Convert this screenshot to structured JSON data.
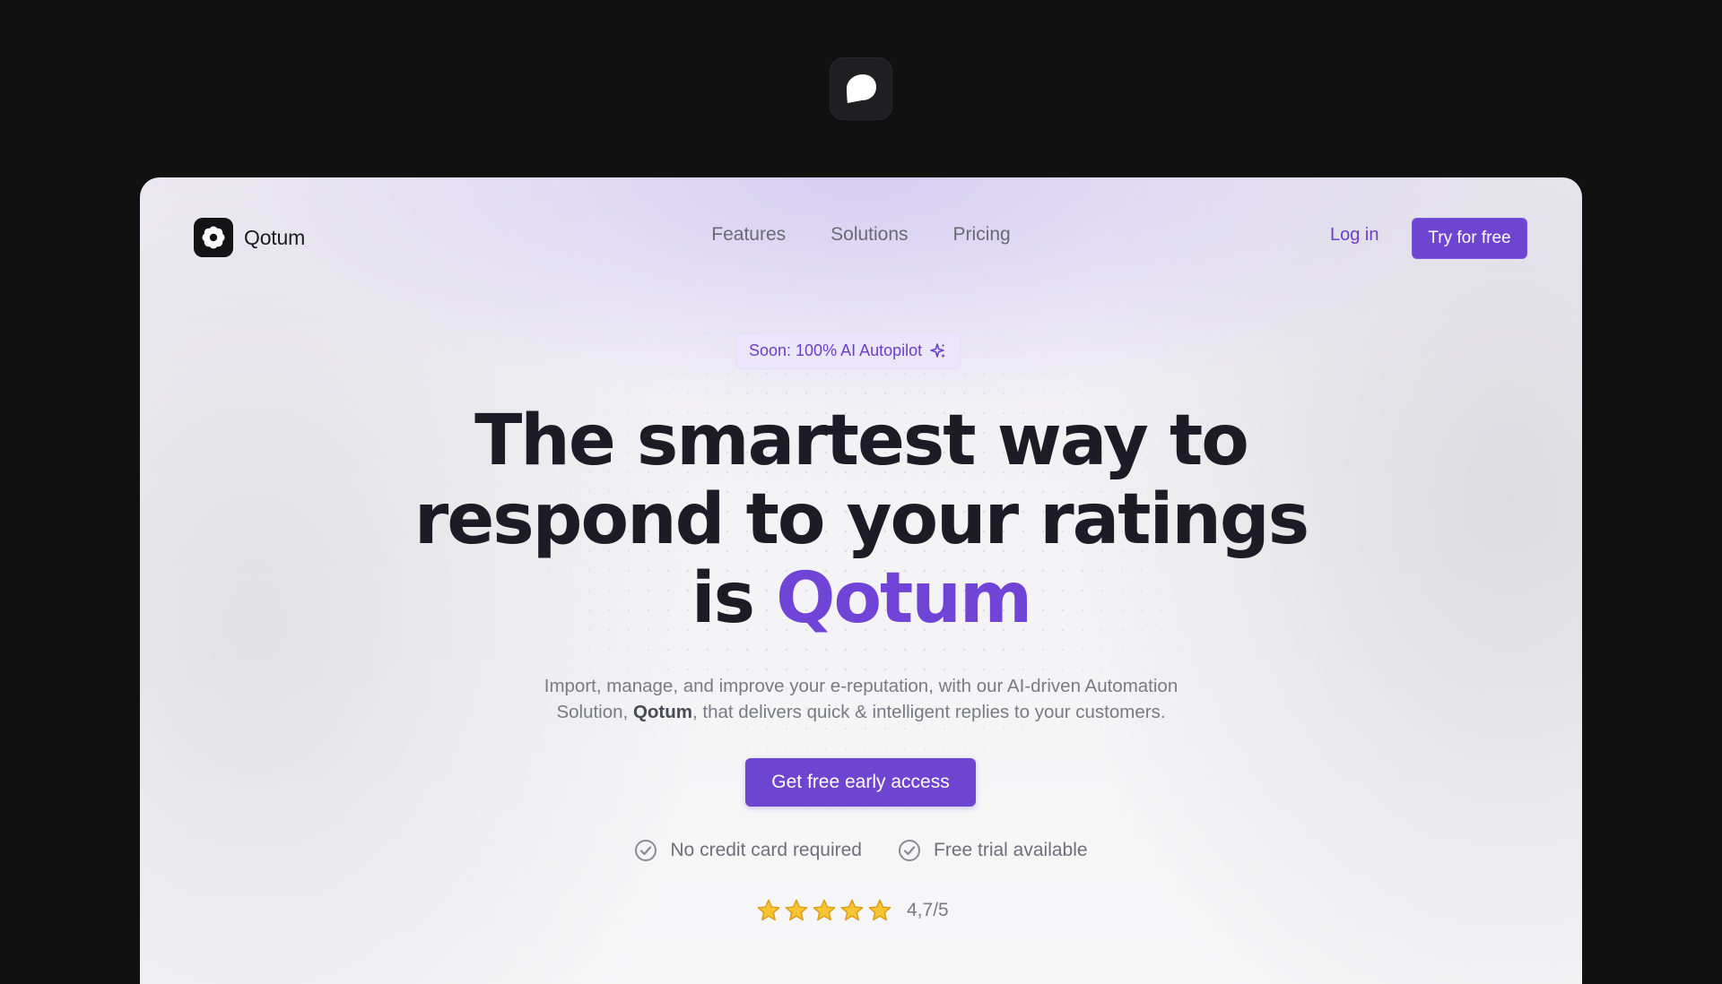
{
  "app_logo": {
    "icon": "speech-bubble-icon"
  },
  "header": {
    "brand": {
      "name": "Qotum",
      "icon": "flower-icon"
    },
    "nav": [
      {
        "label": "Features"
      },
      {
        "label": "Solutions"
      },
      {
        "label": "Pricing"
      }
    ],
    "login_label": "Log in",
    "cta_label": "Try for free"
  },
  "hero": {
    "badge": {
      "text": "Soon: 100% AI Autopilot",
      "icon": "sparkle-icon"
    },
    "headline": {
      "line1": "The smartest way to",
      "line2": "respond to your ratings",
      "line3_prefix": "is ",
      "line3_highlight": "Qotum"
    },
    "subtitle": {
      "part1": "Import, manage, and improve your e-reputation, with our AI-driven Automation",
      "part2_before": "Solution, ",
      "part2_bold": "Qotum",
      "part2_after": ", that delivers quick & intelligent replies to your customers."
    },
    "cta_label": "Get free early access",
    "perks": [
      {
        "label": "No credit card required",
        "icon": "check-circle-icon"
      },
      {
        "label": "Free trial available",
        "icon": "check-circle-icon"
      }
    ],
    "rating": {
      "stars": 5,
      "value_text": "4,7/5"
    }
  },
  "colors": {
    "accent": "#6d45d0",
    "accent_text": "#7044d6",
    "page_bg": "#111112"
  }
}
